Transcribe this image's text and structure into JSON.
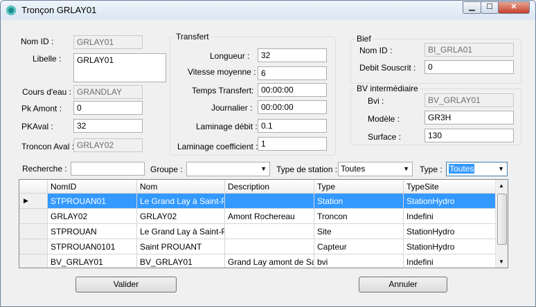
{
  "window": {
    "title": "Tronçon GRLAY01",
    "minimize": "▁",
    "maximize": "☐",
    "close": "✕"
  },
  "general": {
    "nom_id_label": "Nom ID :",
    "nom_id": "GRLAY01",
    "libelle_label": "Libelle :",
    "libelle": "GRLAY01",
    "cours_eau_label": "Cours d'eau :",
    "cours_eau": "GRANDLAY",
    "pk_amont_label": "Pk Amont :",
    "pk_amont": "0",
    "pk_aval_label": "PKAval :",
    "pk_aval": "32",
    "troncon_aval_label": "Troncon Aval :",
    "troncon_aval": "GRLAY02"
  },
  "transfert": {
    "title": "Transfert",
    "longueur_label": "Longueur :",
    "longueur": "32",
    "vitesse_label": "Vitesse moyenne :",
    "vitesse": "6",
    "temps_label": "Temps Transfert:",
    "temps": "00:00:00",
    "journalier_label": "Journalier :",
    "journalier": "00:00:00",
    "laminage_debit_label": "Laminage débit :",
    "laminage_debit": "0.1",
    "laminage_coef_label": "Laminage coefficient :",
    "laminage_coef": "1"
  },
  "bief": {
    "title": "Bief",
    "nom_id_label": "Nom ID :",
    "nom_id": "BI_GRLA01",
    "debit_label": "Debit Souscrit :",
    "debit": "0"
  },
  "bv": {
    "title": "BV intermédiaire",
    "bvi_label": "Bvi :",
    "bvi": "BV_GRLAY01",
    "modele_label": "Modèle :",
    "modele": "GR3H",
    "surface_label": "Surface :",
    "surface": "130"
  },
  "filters": {
    "recherche_label": "Recherche :",
    "recherche": "",
    "groupe_label": "Groupe :",
    "groupe": "",
    "type_station_label": "Type de station :",
    "type_station": "Toutes",
    "type_label": "Type :",
    "type": "Toutes"
  },
  "grid": {
    "columns": [
      "NomID",
      "Nom",
      "Description",
      "Type",
      "TypeSite"
    ],
    "rows": [
      [
        "STPROUAN01",
        "Le Grand Lay à Saint-P...",
        "",
        "Station",
        "StationHydro"
      ],
      [
        "GRLAY02",
        "GRLAY02",
        "Amont Rochereau",
        "Troncon",
        "Indefini"
      ],
      [
        "STPROUAN",
        "Le Grand Lay à Saint-P...",
        "",
        "Site",
        "StationHydro"
      ],
      [
        "STPROUAN0101",
        "Saint PROUANT",
        "",
        "Capteur",
        "StationHydro"
      ],
      [
        "BV_GRLAY01",
        "BV_GRLAY01",
        "Grand Lay amont de Sa...",
        "bvi",
        "Indefini"
      ]
    ]
  },
  "buttons": {
    "valider": "Valider",
    "annuler": "Annuler"
  }
}
